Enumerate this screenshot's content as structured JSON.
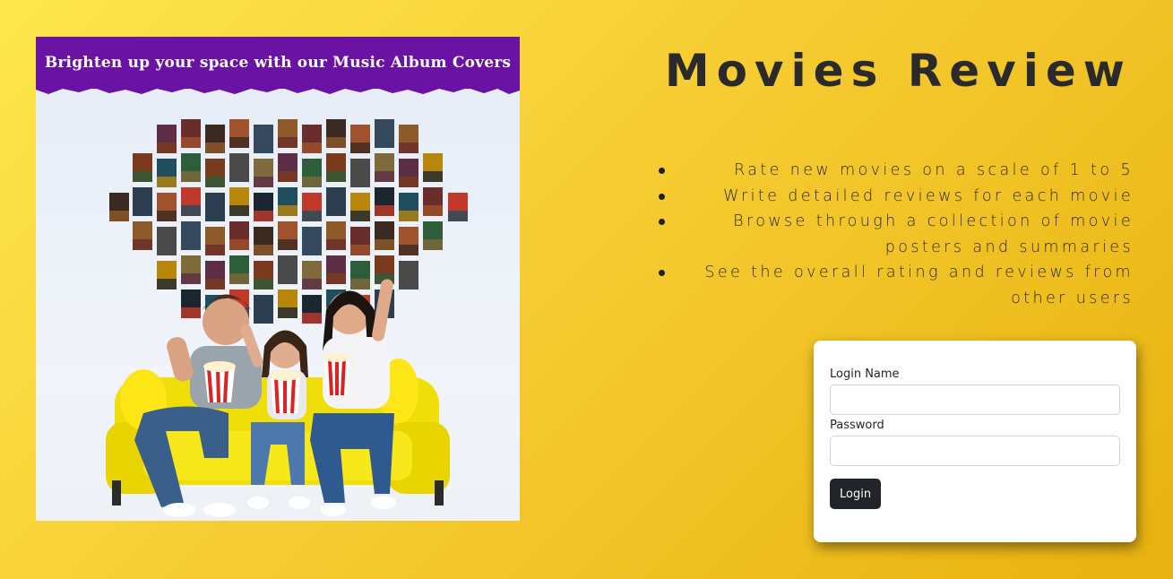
{
  "promo": {
    "banner_text": "Brighten up your space with our Music Album Covers",
    "colors": {
      "banner": "#6a12a3",
      "background": "#e5ecf6",
      "sofa": "#f3e30f"
    }
  },
  "header": {
    "title": "Movies Review"
  },
  "features": [
    "Rate new movies on a scale of 1 to 5",
    "Write detailed reviews for each movie",
    "Browse through a collection of movie posters and summaries",
    "See the overall rating and reviews from other users"
  ],
  "login": {
    "name_label": "Login Name",
    "name_value": "",
    "password_label": "Password",
    "password_value": "",
    "submit_label": "Login"
  },
  "theme": {
    "page_gradient": [
      "#fde74c",
      "#e8b20f"
    ],
    "text": "#2a2a2a",
    "button": "#212529"
  }
}
